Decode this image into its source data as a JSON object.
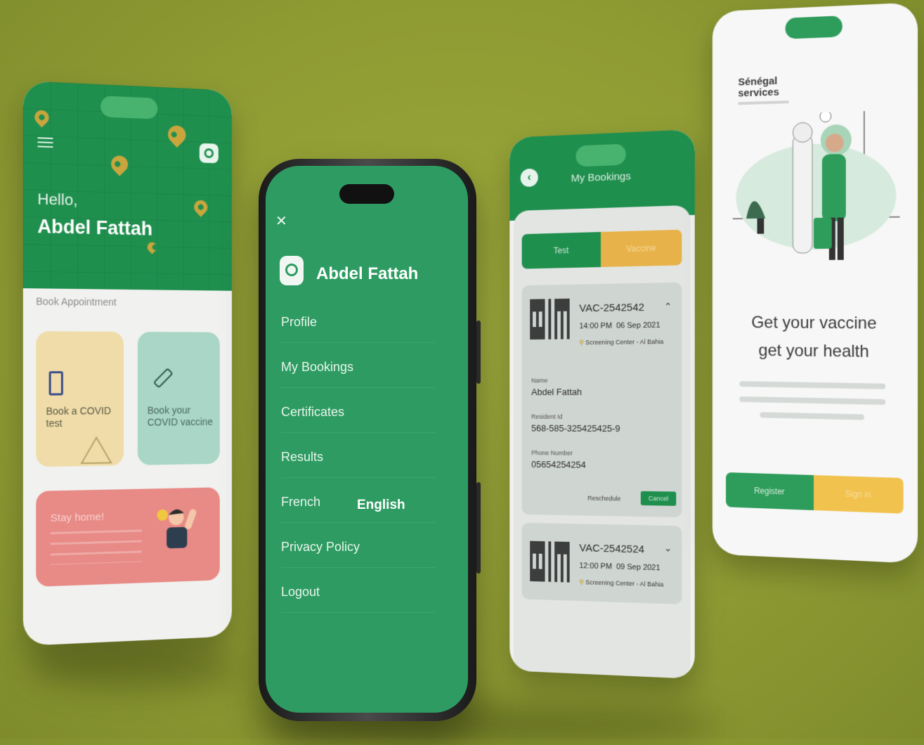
{
  "colors": {
    "background": "#94a236",
    "primary_green": "#1f8f4e",
    "accent_yellow": "#e8b24a",
    "coral": "#e88a86"
  },
  "home": {
    "greeting": "Hello,",
    "user_name": "Abdel Fattah",
    "section_title": "Book Appointment",
    "cards": [
      {
        "label": "Book a COVID test",
        "icon": "test-tube-icon"
      },
      {
        "label": "Book your COVID vaccine",
        "icon": "syringe-icon"
      }
    ],
    "banner": {
      "title": "Stay home!"
    }
  },
  "menu": {
    "user_name": "Abdel Fattah",
    "items": [
      "Profile",
      "My Bookings",
      "Certificates",
      "Results"
    ],
    "language": {
      "option1": "French",
      "option2": "English"
    },
    "items_after": [
      "Privacy Policy",
      "Logout"
    ]
  },
  "bookings": {
    "title": "My Bookings",
    "tabs": [
      "Test",
      "Vaccine"
    ],
    "list": [
      {
        "id": "VAC-2542542",
        "time": "14:00 PM",
        "date": "06 Sep 2021",
        "location": "Screening Center - Al Bahia",
        "expanded": true,
        "fields": [
          {
            "label": "Name",
            "value": "Abdel Fattah"
          },
          {
            "label": "Resident Id",
            "value": "568-585-325425425-9"
          },
          {
            "label": "Phone Number",
            "value": "05654254254"
          }
        ],
        "reschedule_label": "Reschedule",
        "cancel_label": "Cancel"
      },
      {
        "id": "VAC-2542524",
        "time": "12:00 PM",
        "date": "09 Sep 2021",
        "location": "Screening Center - Al Bahia",
        "expanded": false
      }
    ]
  },
  "onboarding": {
    "brand_line1": "Sénégal",
    "brand_line2": "services",
    "headline1": "Get your vaccine",
    "headline2": "get your health",
    "buttons": [
      "Register",
      "Sign in"
    ]
  }
}
